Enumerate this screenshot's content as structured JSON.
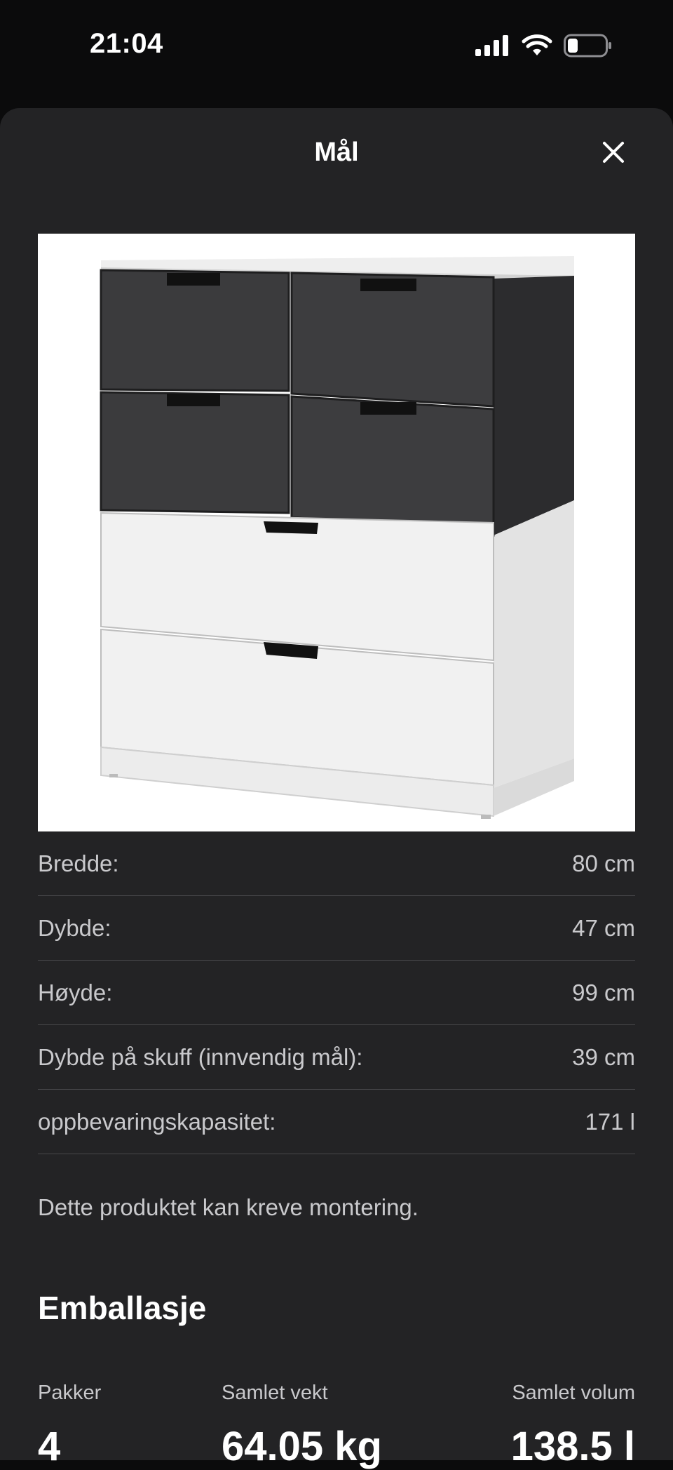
{
  "status_bar": {
    "time": "21:04",
    "icons": [
      "cellular-signal-icon",
      "wifi-icon",
      "battery-icon"
    ]
  },
  "sheet": {
    "title": "Mål",
    "close_icon": "close-icon"
  },
  "product_image": {
    "description_icon": "chest-of-drawers-image"
  },
  "specs": [
    {
      "label": "Bredde:",
      "value": "80 cm"
    },
    {
      "label": "Dybde:",
      "value": "47 cm"
    },
    {
      "label": "Høyde:",
      "value": "99 cm"
    },
    {
      "label": "Dybde på skuff (innvendig mål):",
      "value": "39 cm"
    },
    {
      "label": "oppbevaringskapasitet:",
      "value": "171 l"
    }
  ],
  "note": "Dette produktet kan kreve montering.",
  "packaging": {
    "heading": "Emballasje",
    "columns": [
      {
        "label": "Pakker",
        "value": "4"
      },
      {
        "label": "Samlet vekt",
        "value": "64.05 kg"
      },
      {
        "label": "Samlet volum",
        "value": "138.5 l"
      }
    ]
  },
  "colors": {
    "sheet_bg": "#232325",
    "page_bg": "#0b0b0c",
    "divider": "#48484b",
    "muted_text": "#c9c9cc"
  }
}
